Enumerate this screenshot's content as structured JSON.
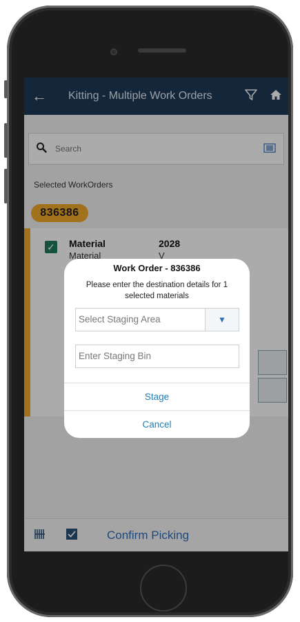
{
  "app_bar": {
    "back_icon": "←",
    "title": "Kitting - Multiple Work Orders",
    "filter_icon": "⛛",
    "home_icon": "⌂"
  },
  "search": {
    "placeholder": "Search",
    "search_icon": "🔍",
    "scan_icon": "⌗"
  },
  "selected_label": "Selected WorkOrders",
  "order_badge": "836386",
  "card": {
    "label": "Material",
    "label2": "Material",
    "value": "2028",
    "value2": "V"
  },
  "bottom_bar": {
    "barcode_icon": "▥",
    "confirm_label": "Confirm Picking"
  },
  "dialog": {
    "title": "Work Order - 836386",
    "message": "Please enter the destination details for 1 selected materials",
    "staging_area_placeholder": "Select Staging Area",
    "staging_bin_placeholder": "Enter Staging Bin",
    "caret_icon": "▼",
    "stage_label": "Stage",
    "cancel_label": "Cancel"
  },
  "colors": {
    "appbar": "#1f3a57",
    "accent": "#f0a92b",
    "link": "#1f7fb3"
  }
}
